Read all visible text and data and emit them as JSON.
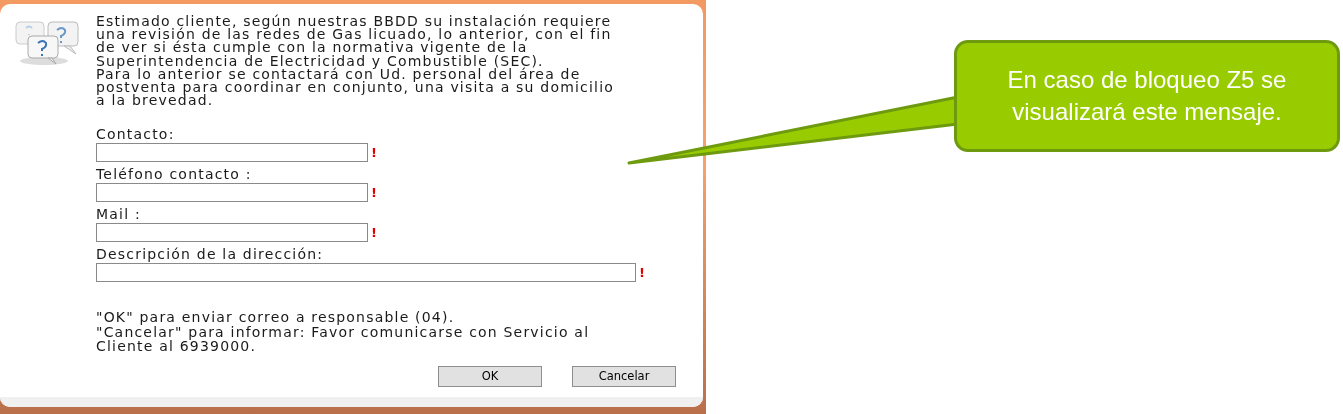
{
  "dialog": {
    "message": [
      "Estimado cliente, según nuestras BBDD su instalación requiere",
      "una revisión de las redes de Gas licuado, lo anterior, con el fin",
      "de ver si ésta cumple con la normativa vigente de la",
      "Superintendencia de Electricidad y Combustible (SEC).",
      "Para lo anterior se contactará con Ud. personal del área de",
      "postventa para coordinar en conjunto, una visita a su domicilio",
      "a la brevedad."
    ],
    "fields": [
      {
        "label": "Contacto:",
        "kind": "short",
        "marker": "!"
      },
      {
        "label": "Teléfono contacto :",
        "kind": "short",
        "marker": "!"
      },
      {
        "label": "Mail :",
        "kind": "short",
        "marker": "!"
      },
      {
        "label": "Descripción de la dirección:",
        "kind": "long",
        "marker": "!"
      }
    ],
    "notes": [
      "\"OK\" para enviar correo a responsable (04).",
      "\"Cancelar\" para informar: Favor comunicarse con Servicio al",
      "Cliente al 6939000."
    ],
    "buttons": [
      "OK",
      "Cancelar"
    ]
  },
  "callout": {
    "text": "En caso de bloqueo Z5 se visualizará este mensaje."
  }
}
